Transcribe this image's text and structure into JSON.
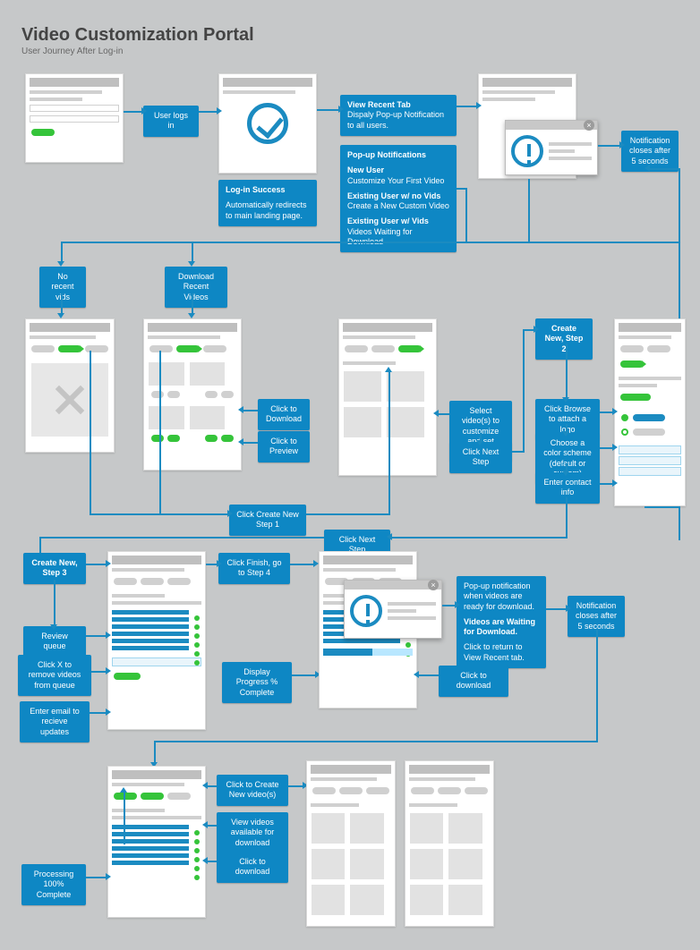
{
  "header": {
    "title": "Video Customization Portal",
    "subtitle": "User Journey After Log-in"
  },
  "row1": {
    "user_logs_in": "User logs in",
    "login_success_title": "Log-in Success",
    "login_success_body": "Automatically redirects to main landing page.",
    "view_recent_title": "View Recent Tab",
    "view_recent_body": "Dispaly Pop-up Notification to all users.",
    "popup_notif_title": "Pop-up Notifications",
    "new_user_title": "New User",
    "new_user_body": "Customize Your First Video",
    "existing_no_vids_title": "Existing User w/ no Vids",
    "existing_no_vids_body": "Create a New Custom Video",
    "existing_vids_title": "Existing User w/ Vids",
    "existing_vids_body": "Videos Waiting for Download",
    "notif_closes": "Notification closes after 5 seconds"
  },
  "row2": {
    "no_recent_vids": "No recent vids",
    "download_recent": "Download Recent Videos"
  },
  "row3": {
    "click_download": "Click to Download",
    "click_preview": "Click to Preview",
    "select_videos": "Select video(s) to customize and set resolution.",
    "click_next_step": "Click Next Step",
    "create_new_step2": "Create New, Step 2",
    "click_browse": "Click Browse to attach a logo",
    "choose_color": "Choose a color scheme (default or custom)",
    "enter_contact": "Enter contact info"
  },
  "row4": {
    "click_create_new_step1": "Click Create New Step 1",
    "click_next_step_mid": "Click Next Step"
  },
  "row5": {
    "create_new_step3": "Create New, Step 3",
    "review_queue": "Review queue",
    "click_x_remove": "Click X to remove videos from queue",
    "enter_email": "Enter email to recieve updates",
    "click_finish": "Click Finish, go to Step 4",
    "display_progress": "Display Progress % Complete",
    "popup_ready_line1": "Pop-up notification when videos are ready for download.",
    "popup_ready_title": "Videos are Waiting for Download.",
    "popup_ready_line2": "Click to return to View Recent tab.",
    "click_to_download": "Click to download",
    "notif_closes2": "Notification closes after 5 seconds"
  },
  "row6": {
    "click_create_new_videos": "Click to Create New video(s)",
    "view_videos_available": "View videos available for download",
    "click_to_download2": "Click to download",
    "processing_complete": "Processing 100% Complete"
  },
  "colors": {
    "blue": "#0e87c4",
    "green": "#35c43a",
    "gray": "#c6c8c9"
  }
}
